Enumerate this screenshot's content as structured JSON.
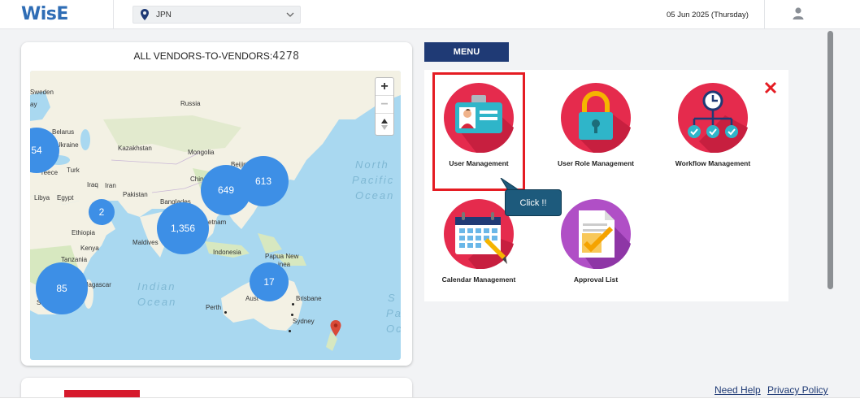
{
  "header": {
    "logo": "WisE",
    "country_selected": "JPN",
    "date": "05 Jun 2025 (Thursday)"
  },
  "map_card": {
    "title": "ALL VENDORS-TO-VENDORS:",
    "count": "4278",
    "zoom_in": "+",
    "zoom_out": "−",
    "clusters": [
      "54",
      "2",
      "649",
      "613",
      "1,356",
      "85",
      "17"
    ],
    "labels": {
      "sweden": "Sweden",
      "russia": "Russia",
      "belarus": "Belarus",
      "ukraine": "Ukraine",
      "kazakhstan": "Kazakhstan",
      "mongolia": "Mongolia",
      "beijing": "Beijing",
      "china": "Chin",
      "greece": "reece",
      "turkey": "Turk",
      "iraq": "Iraq",
      "iran": "Iran",
      "libya": "Libya",
      "egypt": "Egypt",
      "pakistan": "Pakistan",
      "bangladesh": "Banglades",
      "vietnam": "etnam",
      "ethiopia": "Ethiopia",
      "maldives": "Maldives",
      "kenya": "Kenya",
      "indonesia": "Indonesia",
      "papua": "Papua New",
      "guinea": "inea",
      "tanzania": "Tanzania",
      "madagascar": "dagascar",
      "aus": "Aust",
      "brisbane": "Brisbane",
      "perth": "Perth",
      "sydney": "Sydney",
      "sa": "Sa",
      "ay": "ay",
      "north": "North",
      "pacific": "Pacific",
      "ocean1": "Ocean",
      "indian": "Indian",
      "ocean2": "Ocean",
      "s1": "S",
      "pa": "Pa",
      "oc": "Oc"
    }
  },
  "menu": {
    "tab": "MENU",
    "items": [
      {
        "label": "User Management",
        "icon": "id-card-icon"
      },
      {
        "label": "User Role Management",
        "icon": "padlock-icon"
      },
      {
        "label": "Workflow Management",
        "icon": "workflow-icon"
      },
      {
        "label": "Calendar Management",
        "icon": "calendar-icon"
      },
      {
        "label": "Approval List",
        "icon": "approval-document-icon"
      }
    ],
    "callout": "Click !!"
  },
  "footer": {
    "need_help": "Need Help",
    "privacy": "Privacy Policy"
  },
  "colors": {
    "brand_blue": "#2f6db5",
    "menu_navy": "#1f3a75",
    "icon_red": "#e52b4d",
    "cluster_blue": "#3d8fe6",
    "highlight_red": "#e51c23"
  }
}
